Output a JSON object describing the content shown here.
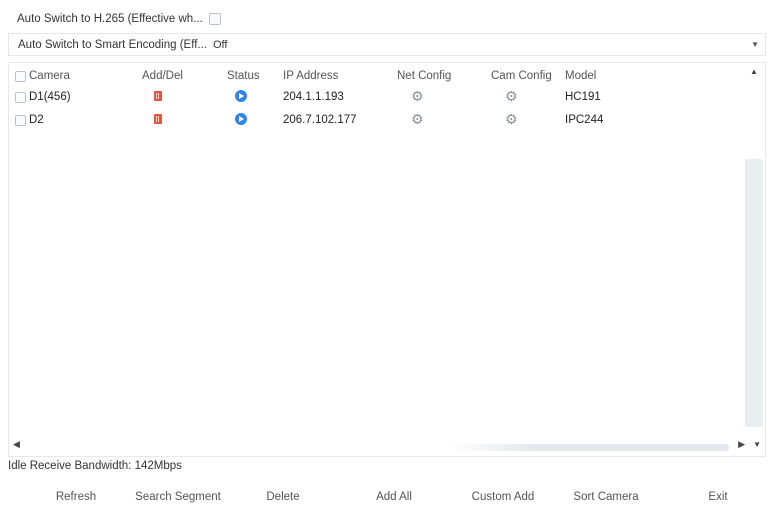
{
  "options": {
    "h265_label": "Auto Switch to H.265 (Effective wh...",
    "h265_checked": false,
    "smart_label": "Auto Switch to Smart Encoding (Eff...",
    "smart_value": "Off"
  },
  "table": {
    "headers": {
      "camera": "Camera",
      "add_del": "Add/Del",
      "status": "Status",
      "ip": "IP Address",
      "net_config": "Net Config",
      "cam_config": "Cam Config",
      "model": "Model"
    },
    "rows": [
      {
        "camera": "D1(456)",
        "ip": "204.1.1.193",
        "model": "HC191"
      },
      {
        "camera": "D2",
        "ip": "206.7.102.177",
        "model": "IPC244"
      }
    ]
  },
  "bandwidth_text": "Idle Receive Bandwidth: 142Mbps",
  "buttons": {
    "refresh": "Refresh",
    "search_segment": "Search Segment",
    "delete": "Delete",
    "add_all": "Add All",
    "custom_add": "Custom Add",
    "sort_camera": "Sort Camera",
    "exit": "Exit"
  },
  "icons": {
    "delete": "delete-icon",
    "status": "play-status-icon",
    "config": "gear-icon"
  },
  "colors": {
    "accent": "#2f86e8",
    "delete_red": "#e0573b"
  }
}
